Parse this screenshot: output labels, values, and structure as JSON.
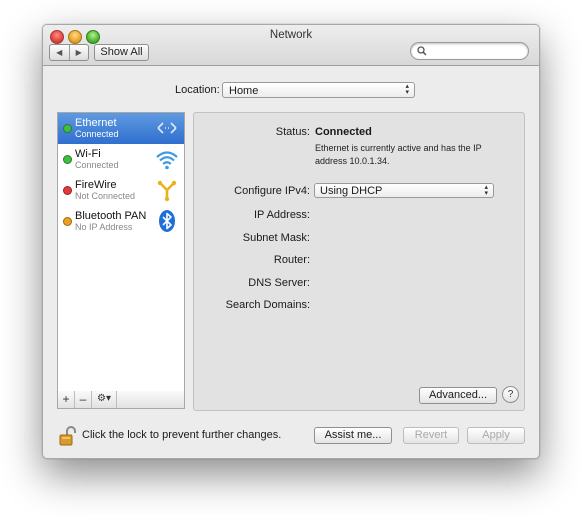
{
  "window": {
    "title": "Network"
  },
  "toolbar": {
    "back_icon": "chevron-left-icon",
    "forward_icon": "chevron-right-icon",
    "show_all_label": "Show All",
    "search_placeholder": ""
  },
  "location": {
    "label": "Location:",
    "value": "Home"
  },
  "services": [
    {
      "name": "Ethernet",
      "status": "Connected",
      "status_color": "#3fbf3f",
      "icon": "ethernet-arrows-icon",
      "selected": true
    },
    {
      "name": "Wi-Fi",
      "status": "Connected",
      "status_color": "#3fbf3f",
      "icon": "wifi-icon",
      "selected": false
    },
    {
      "name": "FireWire",
      "status": "Not Connected",
      "status_color": "#e03a3a",
      "icon": "firewire-icon",
      "selected": false
    },
    {
      "name": "Bluetooth PAN",
      "status": "No IP Address",
      "status_color": "#f0a020",
      "icon": "bluetooth-icon",
      "selected": false
    }
  ],
  "sidebar_buttons": {
    "add": "+",
    "remove": "–",
    "gear": "⚙▾"
  },
  "detail": {
    "status_label": "Status:",
    "status_value": "Connected",
    "status_description": "Ethernet is currently active and has the IP address 10.0.1.34.",
    "configure_label": "Configure IPv4:",
    "configure_value": "Using DHCP",
    "ip_label": "IP Address:",
    "subnet_label": "Subnet Mask:",
    "router_label": "Router:",
    "dns_label": "DNS Server:",
    "search_domains_label": "Search Domains:",
    "advanced_label": "Advanced...",
    "help_label": "?"
  },
  "footer": {
    "lock_text": "Click the lock to prevent further changes.",
    "assist_label": "Assist me...",
    "revert_label": "Revert",
    "apply_label": "Apply"
  },
  "colors": {
    "selection": "#3d7bd6",
    "window_bg": "#ececec"
  }
}
